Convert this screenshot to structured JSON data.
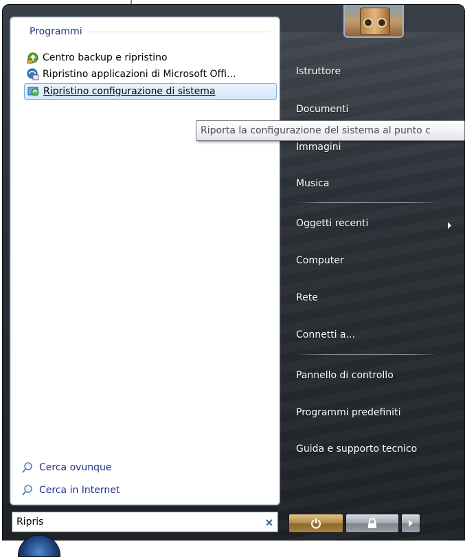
{
  "left_panel": {
    "section_title": "Programmi",
    "programs": [
      {
        "label": "Centro backup e ripristino",
        "icon": "backup-restore-icon"
      },
      {
        "label": "Ripristino applicazioni di Microsoft Offi...",
        "icon": "office-recovery-icon"
      },
      {
        "label": "Ripristino configurazione di sistema",
        "icon": "system-restore-icon",
        "selected": true
      }
    ],
    "search_links": [
      {
        "label": "Cerca ovunque",
        "icon": "search-icon"
      },
      {
        "label": "Cerca in Internet",
        "icon": "search-icon"
      }
    ]
  },
  "search": {
    "value": "Ripris",
    "clear_icon": "×"
  },
  "tooltip": {
    "text": "Riporta la configurazione del sistema al punto c"
  },
  "right_panel": {
    "items": [
      {
        "label": "Istruttore"
      },
      {
        "label": "Documenti"
      },
      {
        "label": "Immagini"
      },
      {
        "label": "Musica"
      },
      {
        "label": "Oggetti recenti",
        "has_submenu": true
      },
      {
        "label": "Computer"
      },
      {
        "label": "Rete"
      },
      {
        "label": "Connetti a..."
      },
      {
        "label": "Pannello di controllo"
      },
      {
        "label": "Programmi predefiniti"
      },
      {
        "label": "Guida e supporto tecnico"
      }
    ]
  },
  "power": {
    "power_icon": "power-icon",
    "lock_icon": "lock-icon",
    "arrow_icon": "arrow-right-icon"
  },
  "colors": {
    "link_blue": "#1e3287",
    "selection_border": "#84acdd",
    "menu_dark": "#2b3036"
  }
}
